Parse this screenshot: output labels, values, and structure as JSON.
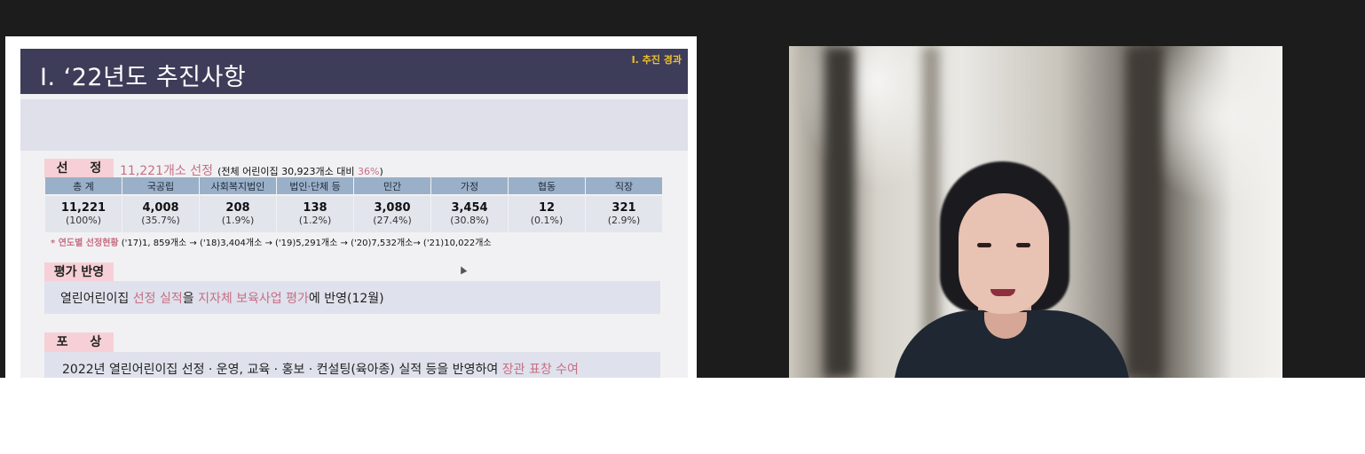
{
  "slide": {
    "title": "Ⅰ. ‘22년도 추진사항",
    "section_tag": "Ⅰ. 추진 경과",
    "selection": {
      "label": "선 정",
      "main": "11,221개소 선정",
      "sub": "(전체 어린이집 30,923개소 대비 ",
      "pct": "36%",
      "close": ")"
    },
    "stats_headers": [
      "총 계",
      "국공립",
      "사회복지법인",
      "법인·단체 등",
      "민간",
      "가정",
      "협동",
      "직장"
    ],
    "stats_values": [
      "11,221",
      "4,008",
      "208",
      "138",
      "3,080",
      "3,454",
      "12",
      "321"
    ],
    "stats_pcts": [
      "(100%)",
      "(35.7%)",
      "(1.9%)",
      "(1.2%)",
      "(27.4%)",
      "(30.8%)",
      "(0.1%)",
      "(2.9%)"
    ],
    "yearly_label": "* 연도별 선정현황",
    "yearly_text": " ('17)1, 859개소 → ('18)3,404개소 → ('19)5,291개소 → ('20)7,532개소→ ('21)10,022개소",
    "evaluation": {
      "label": "평가 반영",
      "p1": "열린어린이집 ",
      "h1": "선정 실적",
      "p2": "을 ",
      "h2": "지자체 보육사업 평가",
      "p3": "에 반영(12월)"
    },
    "award": {
      "label": "포 상",
      "p1": "2022년 열린어린이집 선정 · 운영, 교육 · 홍보 · 컨설팅(육아종) 실적 등을 반영하여 ",
      "h1": "장관 표창 수여"
    }
  },
  "colors": {
    "header": "#3d3d5a",
    "accent_pink": "#c66f84",
    "label_bg": "#f6d0d6",
    "table_header": "#9ab0c8",
    "tag": "#f0c02a"
  }
}
